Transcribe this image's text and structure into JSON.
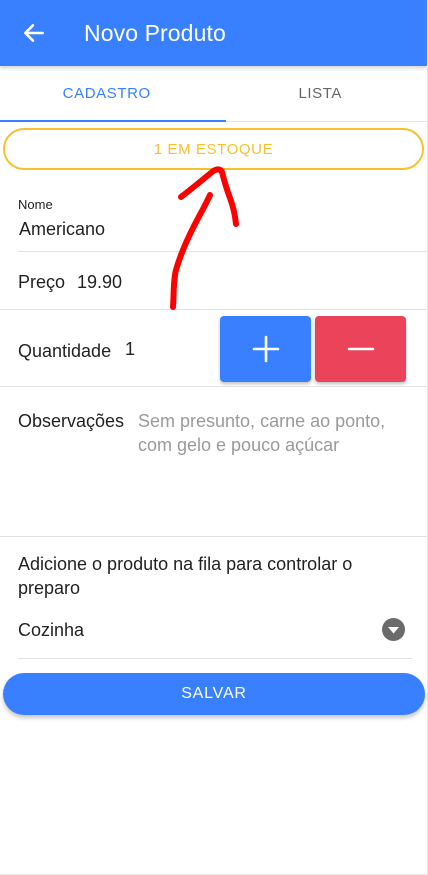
{
  "header": {
    "title": "Novo Produto",
    "back_icon": "arrow-left-icon"
  },
  "tabs": [
    {
      "label": "CADASTRO",
      "active": true
    },
    {
      "label": "LISTA",
      "active": false
    }
  ],
  "stock_badge": {
    "label": "1 EM ESTOQUE"
  },
  "form": {
    "name": {
      "label": "Nome",
      "value": "Americano"
    },
    "price": {
      "label": "Preço",
      "value": "19.90"
    },
    "quantity": {
      "label": "Quantidade",
      "value": "1",
      "increment_icon": "plus-icon",
      "decrement_icon": "minus-icon"
    },
    "notes": {
      "label": "Observações",
      "placeholder": "Sem presunto, carne ao ponto, com gelo e pouco açúcar"
    }
  },
  "queue": {
    "description": "Adicione o produto na fila para controlar o preparo",
    "selected": "Cozinha",
    "dropdown_icon": "caret-down-circle-icon"
  },
  "save_label": "SALVAR",
  "colors": {
    "primary": "#3880ff",
    "danger": "#eb445a",
    "warning": "#f6c12c",
    "annotation": "#ff0000"
  }
}
